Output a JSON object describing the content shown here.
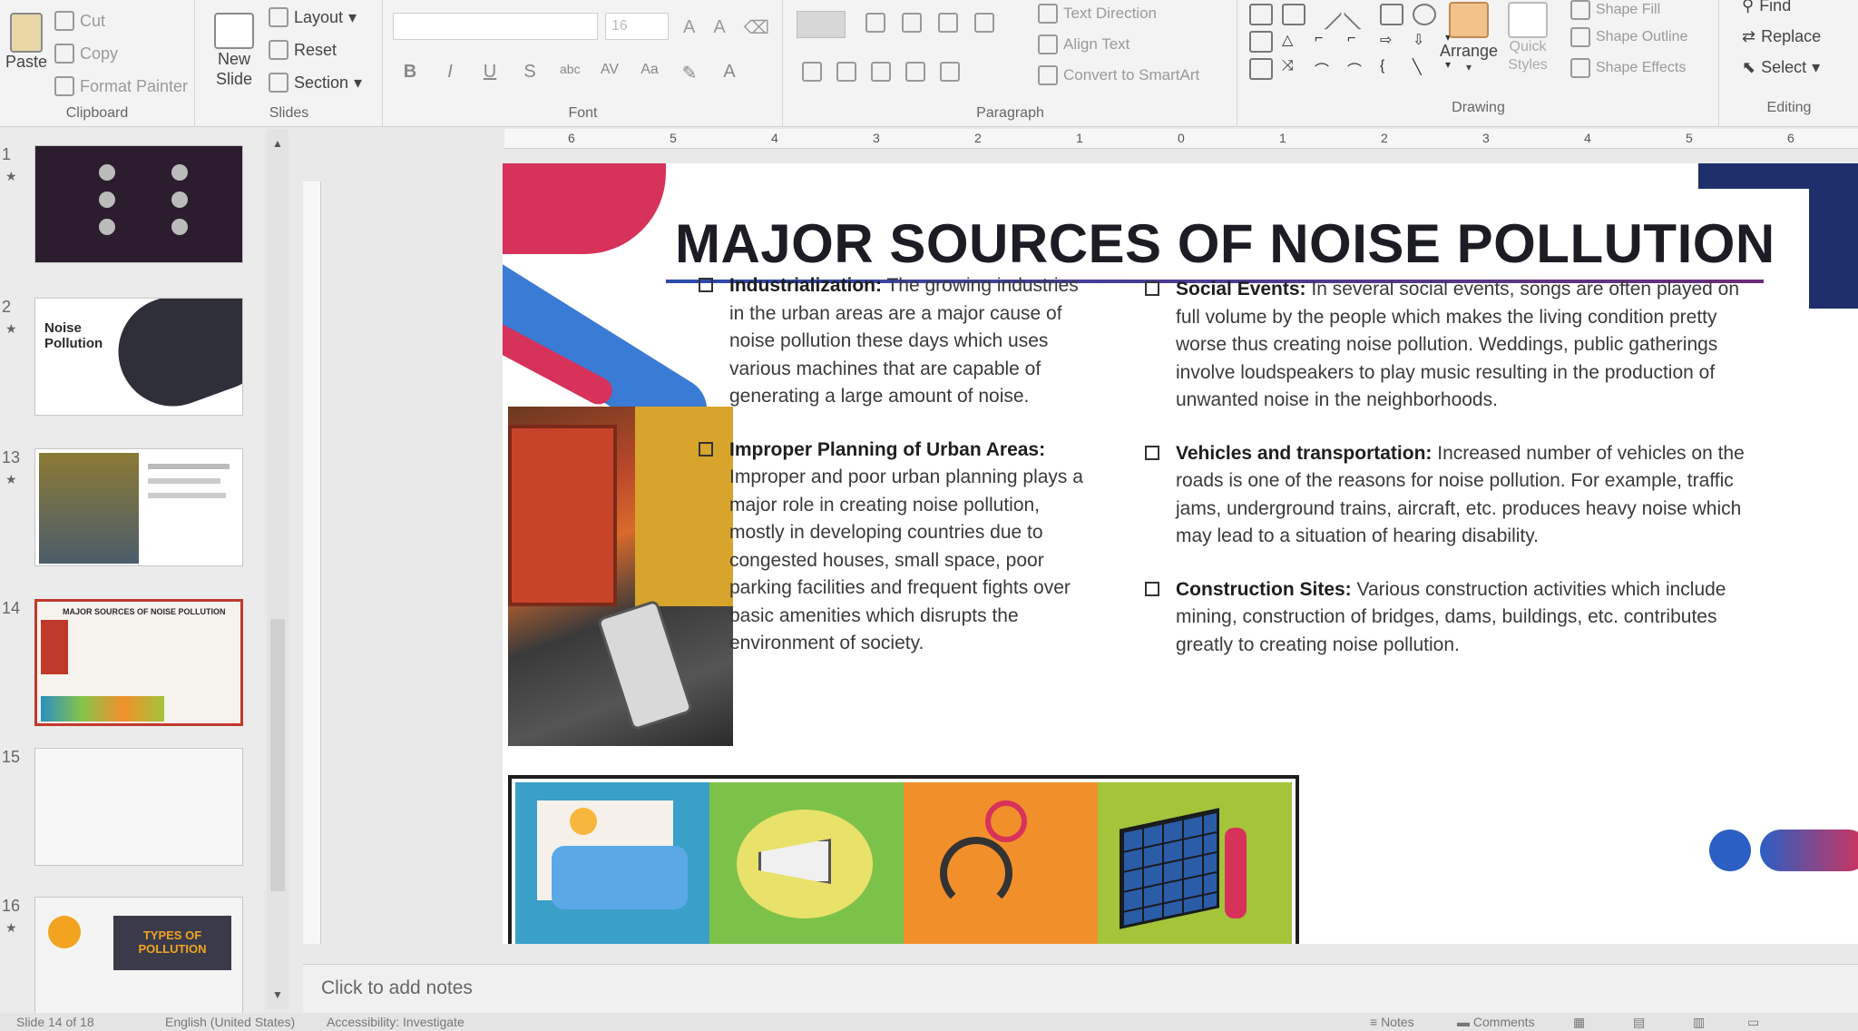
{
  "ribbon": {
    "clipboard": {
      "paste": "Paste",
      "cut": "Cut",
      "copy": "Copy",
      "format_painter": "Format Painter",
      "label": "Clipboard"
    },
    "slides": {
      "new_slide": "New Slide",
      "layout": "Layout",
      "reset": "Reset",
      "section": "Section",
      "label": "Slides"
    },
    "font": {
      "label": "Font",
      "size_placeholder": "16",
      "bold": "B",
      "italic": "I",
      "underline": "U",
      "strike": "S",
      "abc": "abc",
      "spacing": "AV",
      "case": "Aa",
      "color": "A"
    },
    "paragraph": {
      "label": "Paragraph",
      "text_direction": "Text Direction",
      "align_text": "Align Text",
      "convert_smartart": "Convert to SmartArt"
    },
    "drawing": {
      "label": "Drawing",
      "arrange": "Arrange",
      "quick_styles": "Quick Styles",
      "shape_fill": "Shape Fill",
      "shape_outline": "Shape Outline",
      "shape_effects": "Shape Effects"
    },
    "editing": {
      "label": "Editing",
      "find": "Find",
      "replace": "Replace",
      "select": "Select"
    }
  },
  "ruler": {
    "ticks": [
      "6",
      "5",
      "4",
      "3",
      "2",
      "1",
      "0",
      "1",
      "2",
      "3",
      "4",
      "5",
      "6"
    ]
  },
  "thumbnails": [
    {
      "num": "1",
      "title": ""
    },
    {
      "num": "2",
      "title": "Noise Pollution"
    },
    {
      "num": "13",
      "title": ""
    },
    {
      "num": "14",
      "title": "MAJOR SOURCES OF NOISE POLLUTION"
    },
    {
      "num": "15",
      "title": ""
    },
    {
      "num": "16",
      "title": "TYPES OF POLLUTION"
    }
  ],
  "slide": {
    "title": "MAJOR SOURCES OF NOISE POLLUTION",
    "left_items": [
      {
        "head": "Industrialization:",
        "text": " The growing industries in the urban areas are a major cause of noise pollution these days which uses various machines that are capable of generating a large amount of noise."
      },
      {
        "head": "Improper Planning of Urban Areas:",
        "text": " Improper and poor urban planning plays a major role in creating noise pollution, mostly in developing countries due to congested houses, small space, poor parking facilities and frequent fights over basic amenities which disrupts the environment of society."
      }
    ],
    "right_items": [
      {
        "head": "Social Events:",
        "text": " In several social events, songs are often played on full volume by the people which makes the living condition pretty worse thus creating noise pollution. Weddings, public gatherings involve loudspeakers to play music resulting in the production of unwanted noise in the neighborhoods."
      },
      {
        "head": "Vehicles and transportation:",
        "text": " Increased number of vehicles on the roads is one of the reasons for noise pollution. For example, traffic jams, underground trains, aircraft, etc. produces heavy noise which may lead to a situation of hearing disability."
      },
      {
        "head": "Construction Sites:",
        "text": " Various construction activities which include mining, construction of bridges, dams, buildings, etc. contributes greatly to creating noise pollution."
      }
    ],
    "colors": {
      "accent_red": "#d6325a",
      "accent_blue": "#3a7bd5",
      "navy": "#1f2f6b"
    }
  },
  "notes": {
    "placeholder": "Click to add notes"
  },
  "status": {
    "slide_info": "Slide 14 of 18",
    "language": "English (United States)",
    "accessibility": "Accessibility: Investigate",
    "notes": "Notes",
    "comments": "Comments"
  }
}
